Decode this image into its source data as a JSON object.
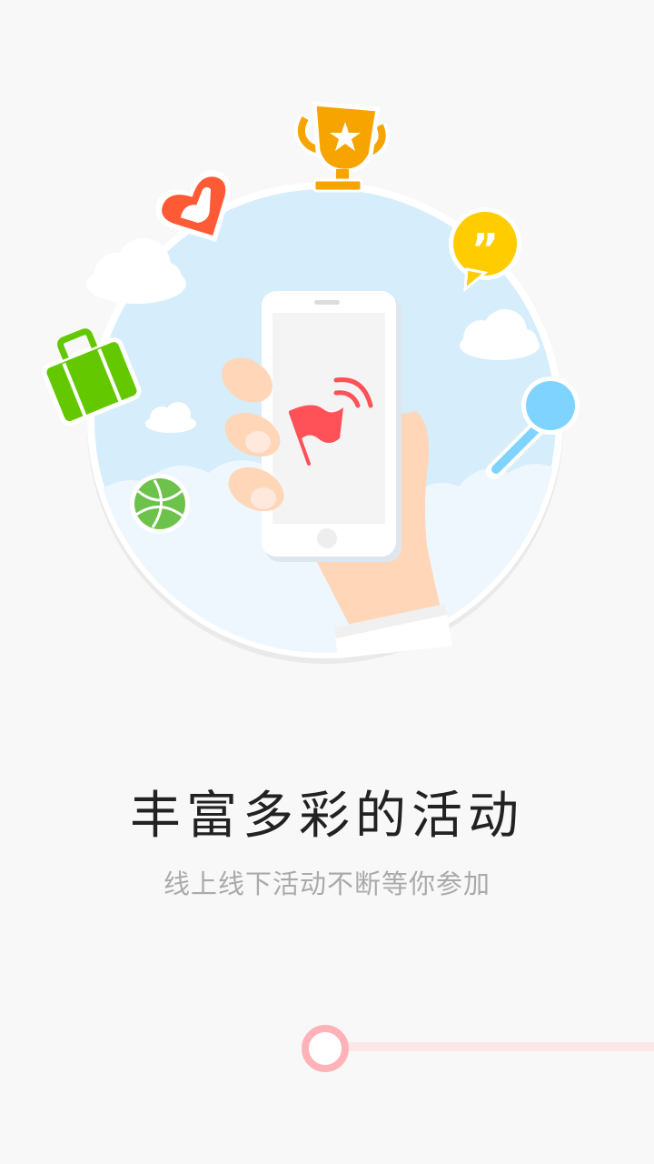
{
  "onboarding": {
    "title": "丰富多彩的活动",
    "subtitle": "线上线下活动不断等你参加",
    "page_indicator": {
      "current_page": 2
    }
  },
  "illustration": {
    "icons": [
      "trophy-icon",
      "heart-hand-icon",
      "quote-bubble-icon",
      "suitcase-icon",
      "microphone-icon",
      "globe-icon",
      "flag-signal-icon",
      "phone-icon"
    ]
  },
  "colors": {
    "background": "#f8f8f8",
    "circle_sky": "#d6edfb",
    "accent_red": "#ff5157",
    "trophy": "#f7a400",
    "heart": "#ff5a36",
    "bubble": "#ffcc00",
    "suitcase": "#64c800",
    "microphone": "#7fd3ff",
    "globe": "#6cc24a",
    "pager": "#ffb3b8"
  }
}
